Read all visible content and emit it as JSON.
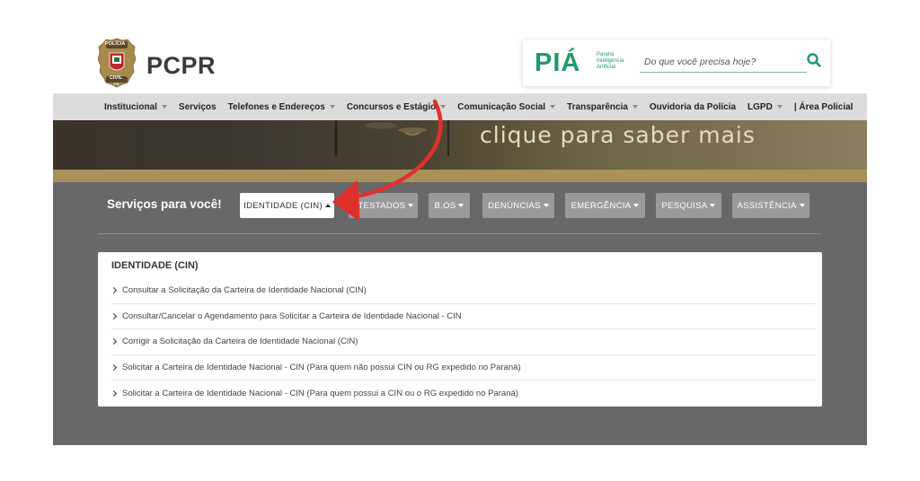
{
  "header": {
    "badge_top": "POLÍCIA",
    "badge_bottom": "CIVIL",
    "badge_state": "PR",
    "logo_text": "PCPR"
  },
  "pia": {
    "mark": "PIÁ",
    "tagline": [
      "Paraná",
      "Inteligência",
      "Artificial"
    ],
    "search_placeholder": "Do que você precisa hoje?",
    "search_icon": "search-icon",
    "color": "#1f9b6a"
  },
  "nav": {
    "items": [
      {
        "label": "Institucional",
        "dropdown": true
      },
      {
        "label": "Serviços",
        "dropdown": false
      },
      {
        "label": "Telefones e Endereços",
        "dropdown": true
      },
      {
        "label": "Concursos e Estágio",
        "dropdown": true
      },
      {
        "label": "Comunicação Social",
        "dropdown": true
      },
      {
        "label": "Transparência",
        "dropdown": true
      },
      {
        "label": "Ouvidoria da Polícia",
        "dropdown": false
      },
      {
        "label": "LGPD",
        "dropdown": true
      },
      {
        "label": "| Área Policial",
        "dropdown": false
      }
    ]
  },
  "banner": {
    "text": "clique para saber mais"
  },
  "services": {
    "title": "Serviços para você!",
    "buttons": [
      {
        "label": "IDENTIDADE (CIN)",
        "active": true
      },
      {
        "label": "ATESTADOS",
        "active": false
      },
      {
        "label": "B.OS",
        "active": false
      },
      {
        "label": "DENÚNCIAS",
        "active": false
      },
      {
        "label": "EMERGÊNCIA",
        "active": false
      },
      {
        "label": "PESQUISA",
        "active": false
      },
      {
        "label": "ASSISTÊNCIA",
        "active": false
      }
    ],
    "panel": {
      "title": "IDENTIDADE (CIN)",
      "items": [
        "Consultar a Solicitação da Carteira de Identidade Nacional (CIN)",
        "Consultar/Cancelar o Agendamento para Solicitar a Carteira de Identidade Nacional - CIN",
        "Corrigir a Solicitação da Carteira de Identidade Nacional (CIN)",
        "Solicitar a Carteira de Identidade Nacional - CIN (Para quem não possui CIN ou RG expedido no Paraná)",
        "Solicitar a Carteira de Identidade Nacional - CIN (Para quem possui a CIN ou o RG expedido no Paraná)"
      ]
    }
  },
  "colors": {
    "nav_bg": "#dcdcdc",
    "section_bg": "#68686b",
    "button_bg": "#9a9a9c",
    "gold": "#a8925a",
    "arrow": "#e0302c"
  }
}
